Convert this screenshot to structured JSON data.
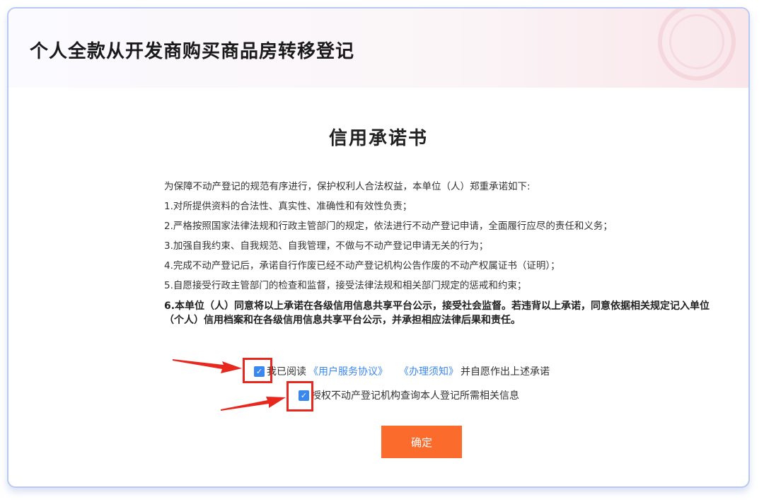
{
  "header": {
    "title": "个人全款从开发商购买商品房转移登记"
  },
  "document": {
    "title": "信用承诺书",
    "paragraphs": [
      "为保障不动产登记的规范有序进行，保护权利人合法权益，本单位（人）郑重承诺如下:",
      "1.对所提供资料的合法性、真实性、准确性和有效性负责；",
      "2.严格按照国家法律法规和行政主管部门的规定，依法进行不动产登记申请，全面履行应尽的责任和义务；",
      "3.加强自我约束、自我规范、自我管理，不做与不动产登记申请无关的行为；",
      "4.完成不动产登记后，承诺自行作废已经不动产登记机构公告作废的不动产权属证书（证明）；",
      "5.自愿接受行政主管部门的检查和监督，接受法律法规和相关部门规定的惩戒和约束；"
    ],
    "bold_paragraph": "6.本单位（人）同意将以上承诺在各级信用信息共享平台公示，接受社会监督。若违背以上承诺，同意依据相关规定记入单位（个人）信用档案和在各级信用信息共享平台公示，并承担相应法律后果和责任。"
  },
  "agreement": {
    "read_prefix": "我已阅读",
    "link_service": "《用户服务协议》",
    "link_notice": "《办理须知》",
    "read_suffix": "并自愿作出上述承诺",
    "authorize_text": "授权不动产登记机构查询本人登记所需相关信息",
    "read_checked": true,
    "authorize_checked": true
  },
  "confirm_button": "确定",
  "icons": {
    "checkbox": "check-icon",
    "annotation": "red-arrow-icon"
  },
  "colors": {
    "accent": "#3a87f0",
    "button": "#fa6b2c",
    "annotation": "#e8281e",
    "card_border": "#b9c9ef"
  }
}
